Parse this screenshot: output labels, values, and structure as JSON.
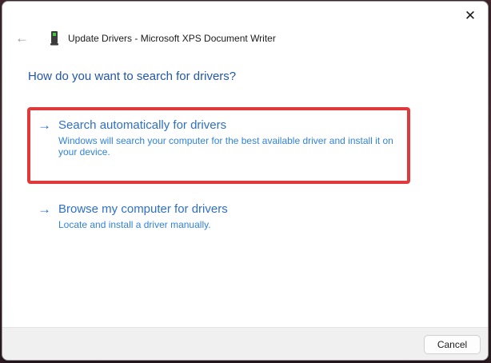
{
  "window": {
    "title": "Update Drivers - Microsoft XPS Document Writer"
  },
  "icons": {
    "close_icon": "✕",
    "back_icon": "←",
    "option_arrow_icon": "→"
  },
  "heading": "How do you want to search for drivers?",
  "options": [
    {
      "title": "Search automatically for drivers",
      "description": "Windows will search your computer for the best available driver and install it on your device.",
      "description_lines": [
        "Windows will search your computer for the best available driver and install it on",
        "your device."
      ],
      "highlighted": true
    },
    {
      "title": "Browse my computer for drivers",
      "description": "Locate and install a driver manually.",
      "description_lines": [
        "Locate and install a driver manually."
      ],
      "highlighted": false
    }
  ],
  "footer": {
    "cancel_label": "Cancel"
  },
  "colors": {
    "heading_blue": "#2456a8",
    "link_blue": "#2e6fc7",
    "desc_blue": "#3183d8",
    "annotation_red": "#e0393c",
    "title_text": "#1b1b1b",
    "footer_bg": "#f0f0f0",
    "window_bg": "#ffffff",
    "desktop_bg": "#42262e"
  }
}
